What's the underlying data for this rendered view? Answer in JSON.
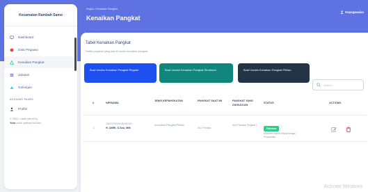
{
  "sidebar": {
    "brand": "Kecamatan Rambah Samo",
    "items": [
      {
        "label": "Dashboard",
        "icon": "monitor-icon",
        "color": "#5e72e4"
      },
      {
        "label": "Data Pegawai",
        "icon": "user-circle-icon",
        "color": "#f5365c"
      },
      {
        "label": "Kenaikan Pangkat",
        "icon": "triangle-icon",
        "color": "#2dce89",
        "active": true
      },
      {
        "label": "Jabatan",
        "icon": "list-icon",
        "color": "#5e72e4"
      },
      {
        "label": "Golongan",
        "icon": "layers-icon",
        "color": "#11cdef"
      }
    ],
    "section": "ACCOUNT PAGES",
    "profile": {
      "label": "Profile",
      "icon": "person-icon",
      "color": "#344767"
    },
    "footer_line1": "© 2023, made with ♥ by",
    "footer_brand": "Yolo",
    "footer_line2": "untuk aplikasi terbaru."
  },
  "header": {
    "breadcrumb": "Pages / Kenaikan Pangkat",
    "title": "Kenaikan Pangkat",
    "user": "Kepegawaian"
  },
  "card": {
    "title": "Tabel Kenaikan Pangkat",
    "subtitle": "Daftar pegawai yang ada di usulan kenaikan pangkat.",
    "buttons": {
      "reguler": "Buat Usulan Kenaikan Pangkat Reguler",
      "struktural": "Buat Usulan Kenaikan Pangkat Struktural",
      "pilihan": "Buat Usulan Kenaikan Pangkat Pilihan"
    },
    "search_placeholder": "Search"
  },
  "table": {
    "columns": [
      "#",
      "NIP/NAMA",
      "JENIS KEPANGKATAN",
      "PANGKAT SAAT INI",
      "PANGKAT YANG DIUSULKAN",
      "STATUS",
      "ACTIONS"
    ],
    "rows": [
      {
        "no": "1",
        "nip": "196707032014091001",
        "nama": "H. AMRI, S.Sos, MM",
        "jenis": "Kenaikan Pangkat Pilihan",
        "pangkat_saat_ini": "III/c Penata",
        "pangkat_diusulkan": "III/d Penata Tingkat I",
        "status": "Diterima",
        "status_note": "Dokumen Sudah Sesuai dengan Persyaratan"
      }
    ]
  },
  "watermark": "Activate Windows",
  "colors": {
    "primary": "#5e72e4",
    "success": "#2dce89",
    "danger": "#f5365c"
  }
}
